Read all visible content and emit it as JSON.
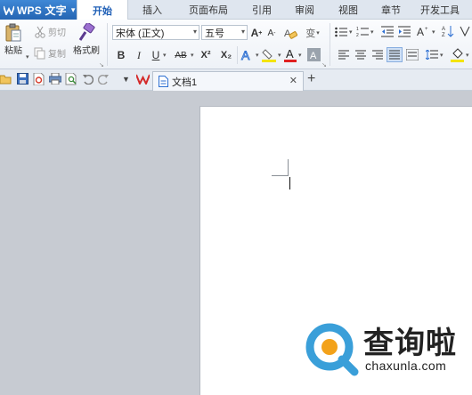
{
  "app": {
    "name": "WPS 文字",
    "accent": "#2565b3"
  },
  "menu": {
    "tabs": [
      {
        "label": "开始",
        "active": true
      },
      {
        "label": "插入"
      },
      {
        "label": "页面布局"
      },
      {
        "label": "引用"
      },
      {
        "label": "审阅"
      },
      {
        "label": "视图"
      },
      {
        "label": "章节"
      },
      {
        "label": "开发工具"
      }
    ]
  },
  "ribbon": {
    "clipboard": {
      "paste": "粘贴",
      "cut": "剪切",
      "copy": "复制",
      "format_painter": "格式刷"
    },
    "font": {
      "name": "宋体 (正文)",
      "size": "五号",
      "bold": "B",
      "italic": "I",
      "underline": "U",
      "strike": "AB",
      "superscript": "X²",
      "subscript": "X₂"
    }
  },
  "quickbar": {
    "document_tab": "文档1",
    "new_tab": "+"
  },
  "watermark": {
    "brand_cn": "查询啦",
    "url": "chaxunla.com",
    "colors": {
      "ring": "#3a9fd9",
      "dot": "#f3a21a"
    }
  }
}
